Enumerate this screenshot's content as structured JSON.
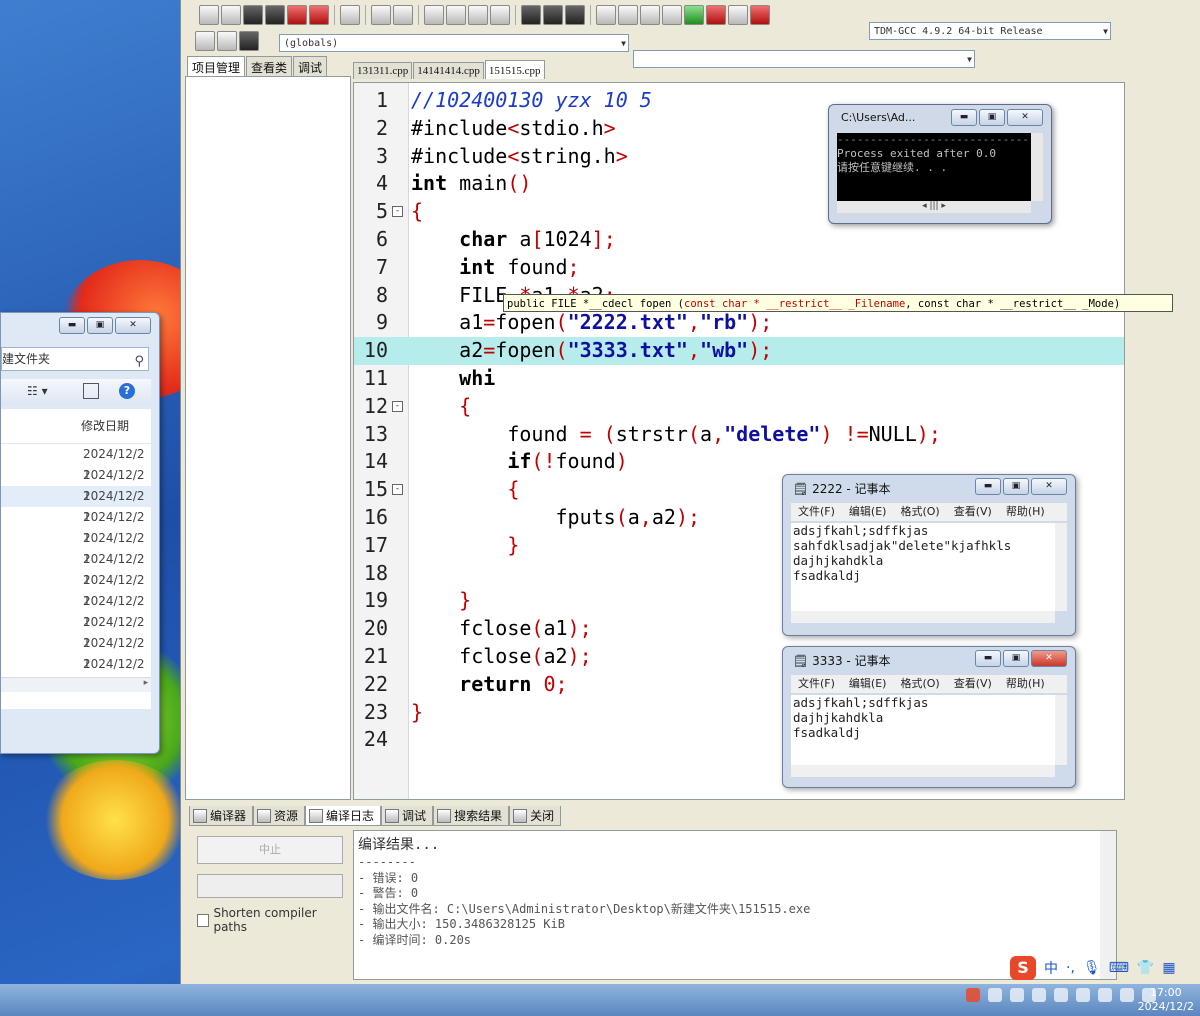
{
  "explorer": {
    "search_text": "建文件夹",
    "column_header": "修改日期",
    "rows": [
      "2024/12/2 1",
      "2024/12/2 1",
      "2024/12/2 1",
      "2024/12/2 1",
      "2024/12/2 1",
      "2024/12/2 1",
      "2024/12/2 1",
      "2024/12/2 1",
      "2024/12/2 1",
      "2024/12/2 1",
      "2024/12/2 1"
    ]
  },
  "ide": {
    "scope_combo": "(globals)",
    "compiler_combo": "TDM-GCC 4.9.2 64-bit Release",
    "left_tabs": [
      "项目管理",
      "查看类",
      "调试"
    ],
    "file_tabs": [
      "131311.cpp",
      "14141414.cpp",
      "151515.cpp"
    ],
    "active_file": "151515.cpp"
  },
  "editor": {
    "line_numbers": [
      "1",
      "2",
      "3",
      "4",
      "5",
      "6",
      "7",
      "8",
      "9",
      "10",
      "11",
      "12",
      "13",
      "14",
      "15",
      "16",
      "17",
      "18",
      "19",
      "20",
      "21",
      "22",
      "23",
      "24"
    ],
    "tooltip": {
      "head": "public FILE *__cdecl fopen (",
      "p1": "const char * __restrict__ _Filename",
      "sep": ", const char * __restrict__ _Mode)"
    }
  },
  "console": {
    "title": "C:\\Users\\Ad...",
    "lines": [
      "--------------------------------",
      "Process exited after 0.0",
      "请按任意键继续. . ."
    ]
  },
  "notepad_2222": {
    "title": "2222 - 记事本",
    "menu": [
      "文件(F)",
      "编辑(E)",
      "格式(O)",
      "查看(V)",
      "帮助(H)"
    ],
    "lines": [
      "adsjfkahl;sdffkjas",
      "sahfdklsadjak\"delete\"kjafhkls",
      "dajhjkahdkla",
      "fsadkaldj"
    ]
  },
  "notepad_3333": {
    "title": "3333 - 记事本",
    "menu": [
      "文件(F)",
      "编辑(E)",
      "格式(O)",
      "查看(V)",
      "帮助(H)"
    ],
    "lines": [
      "adsjfkahl;sdffkjas",
      "dajhjkahdkla",
      "fsadkaldj"
    ]
  },
  "bottom": {
    "tabs": [
      "编译器",
      "资源",
      "编译日志",
      "调试",
      "搜索结果",
      "关闭"
    ],
    "abort_label": "中止",
    "shorten_label": "Shorten compiler paths",
    "log_lines": [
      "编译结果...",
      "--------",
      "- 错误: 0",
      "- 警告: 0",
      "- 输出文件名: C:\\Users\\Administrator\\Desktop\\新建文件夹\\151515.exe",
      "- 输出大小: 150.3486328125 KiB",
      "- 编译时间: 0.20s"
    ]
  },
  "taskbar": {
    "ime": [
      "中",
      "·,",
      "S"
    ],
    "time": "17:00",
    "date": "2024/12/2"
  }
}
